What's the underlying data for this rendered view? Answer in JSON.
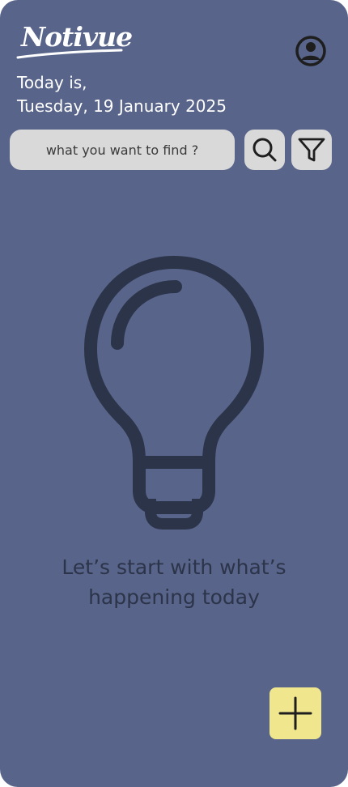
{
  "app": {
    "name": "Notivue"
  },
  "header": {
    "date_label": "Today is,",
    "date_value": "Tuesday, 19 January 2025",
    "profile_icon": "user-circle-icon"
  },
  "search": {
    "placeholder": "what you want to find ?",
    "value": "",
    "search_icon": "search-icon",
    "filter_icon": "filter-icon"
  },
  "empty_state": {
    "icon": "lightbulb-icon",
    "message_line1": "Let’s start with what’s",
    "message_line2": "happening today"
  },
  "fab": {
    "icon": "plus-icon"
  },
  "colors": {
    "background": "#58648a",
    "input_background": "#d9d9d9",
    "empty_icon": "#2c3449",
    "fab_background": "#f0e68e"
  }
}
